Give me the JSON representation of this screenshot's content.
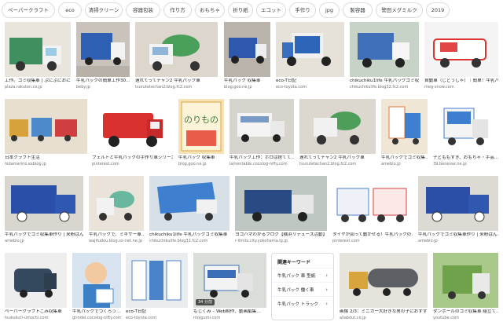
{
  "chips": [
    "ペーパークラフト",
    "eco",
    "清掃クリーン",
    "容器包装",
    "作り方",
    "おもちゃ",
    "折り紙",
    "エコット",
    "手作り",
    "jpg",
    "製容器",
    "警田メグミルク",
    "2019"
  ],
  "images": [
    {
      "caption": "工作。ゴミ収集車 | ぷにぷにおにい…",
      "source": "plaza.rakuten.co.jp"
    },
    {
      "caption": "牛乳パックの簡単工作30…",
      "source": "beby.jp"
    },
    {
      "caption": "遠れてってチャン2 牛乳パック車",
      "source": "tsurutetechan2.blog.fc2.com"
    },
    {
      "caption": "牛乳パック 収集車",
      "source": "blog.goo.ne.jp"
    },
    {
      "caption": "eco-T日記",
      "source": "eco-toyota.com"
    },
    {
      "caption": "chikuchiku1life 牛乳パックゴミ収集…",
      "source": "chikuchikulife.blog32.fc2.com"
    },
    {
      "caption": "自動車（じどうしゃ）｜簡単！牛乳パック…",
      "source": "meg-snow.com"
    },
    {
      "caption": "日本クラフト生活",
      "source": "hidamarino.exblog.jp"
    },
    {
      "caption": "フェルトと牛乳パックの手作り車シリーズ…",
      "source": "pinterest.com"
    },
    {
      "caption": "牛乳パック 収集車",
      "source": "blog.goo.ne.jp"
    },
    {
      "caption": "牛乳パック工作：ボロは捨てて…",
      "source": "lamentable.cocolog-nifty.com"
    },
    {
      "caption": "遠れてってチャン2 牛乳パック車",
      "source": "tsurutetechan2.blog.fc2.com"
    },
    {
      "caption": "牛乳パックでゴミ収集…",
      "source": "ameblo.jp"
    },
    {
      "caption": "子どももすき、おもちゃ・手芸…",
      "source": "39.benesse.ne.jp"
    },
    {
      "caption": "牛乳パックでゴミ収集車作り | 米粉ぱん…",
      "source": "ameblo.jp"
    },
    {
      "caption": "牛乳パックで、ミキサー車…",
      "source": "wajifudou.blog.so-net.ne.jp"
    },
    {
      "caption": "chikuchiku1life 牛乳パックゴミ収集車",
      "source": "chikuchikulife.blog32.fc2.com"
    },
    {
      "caption": "ヨコハマわかるブログ【横浜リデュース活動】",
      "source": "r-limits.city.yokohama.lg.jp"
    },
    {
      "caption": "タイヤが回って動かせる！牛乳パックの…",
      "source": "pinterest.com"
    },
    {
      "caption": "牛乳パックでゴミ収集車作り | 米粉ぱん…",
      "source": "ameblo.jp"
    },
    {
      "caption": "ペーパークラフトごみ収集車",
      "source": "tsukukuri-umochi.com"
    },
    {
      "caption": "牛乳パックでつくろう…",
      "source": "grindel.cocolog-nifty.com"
    },
    {
      "caption": "eco-T日記",
      "source": "eco-toyota.com"
    },
    {
      "caption": "もじくみ – Web制作、動画編集…",
      "source": "mojgumi.com",
      "badge": "34 分前"
    },
    {
      "caption": "画像 2/3：ミニカー大好きな男の子におすすめ…",
      "source": "allabout.co.jp"
    },
    {
      "caption": "ダンボールのゴミ収集車 組立て…",
      "source": "youtube.com"
    }
  ],
  "related": {
    "heading": "関連キーワード",
    "items": [
      "牛乳パック 車 型紙",
      "牛乳パック 働く車",
      "牛乳パック トラック"
    ]
  }
}
